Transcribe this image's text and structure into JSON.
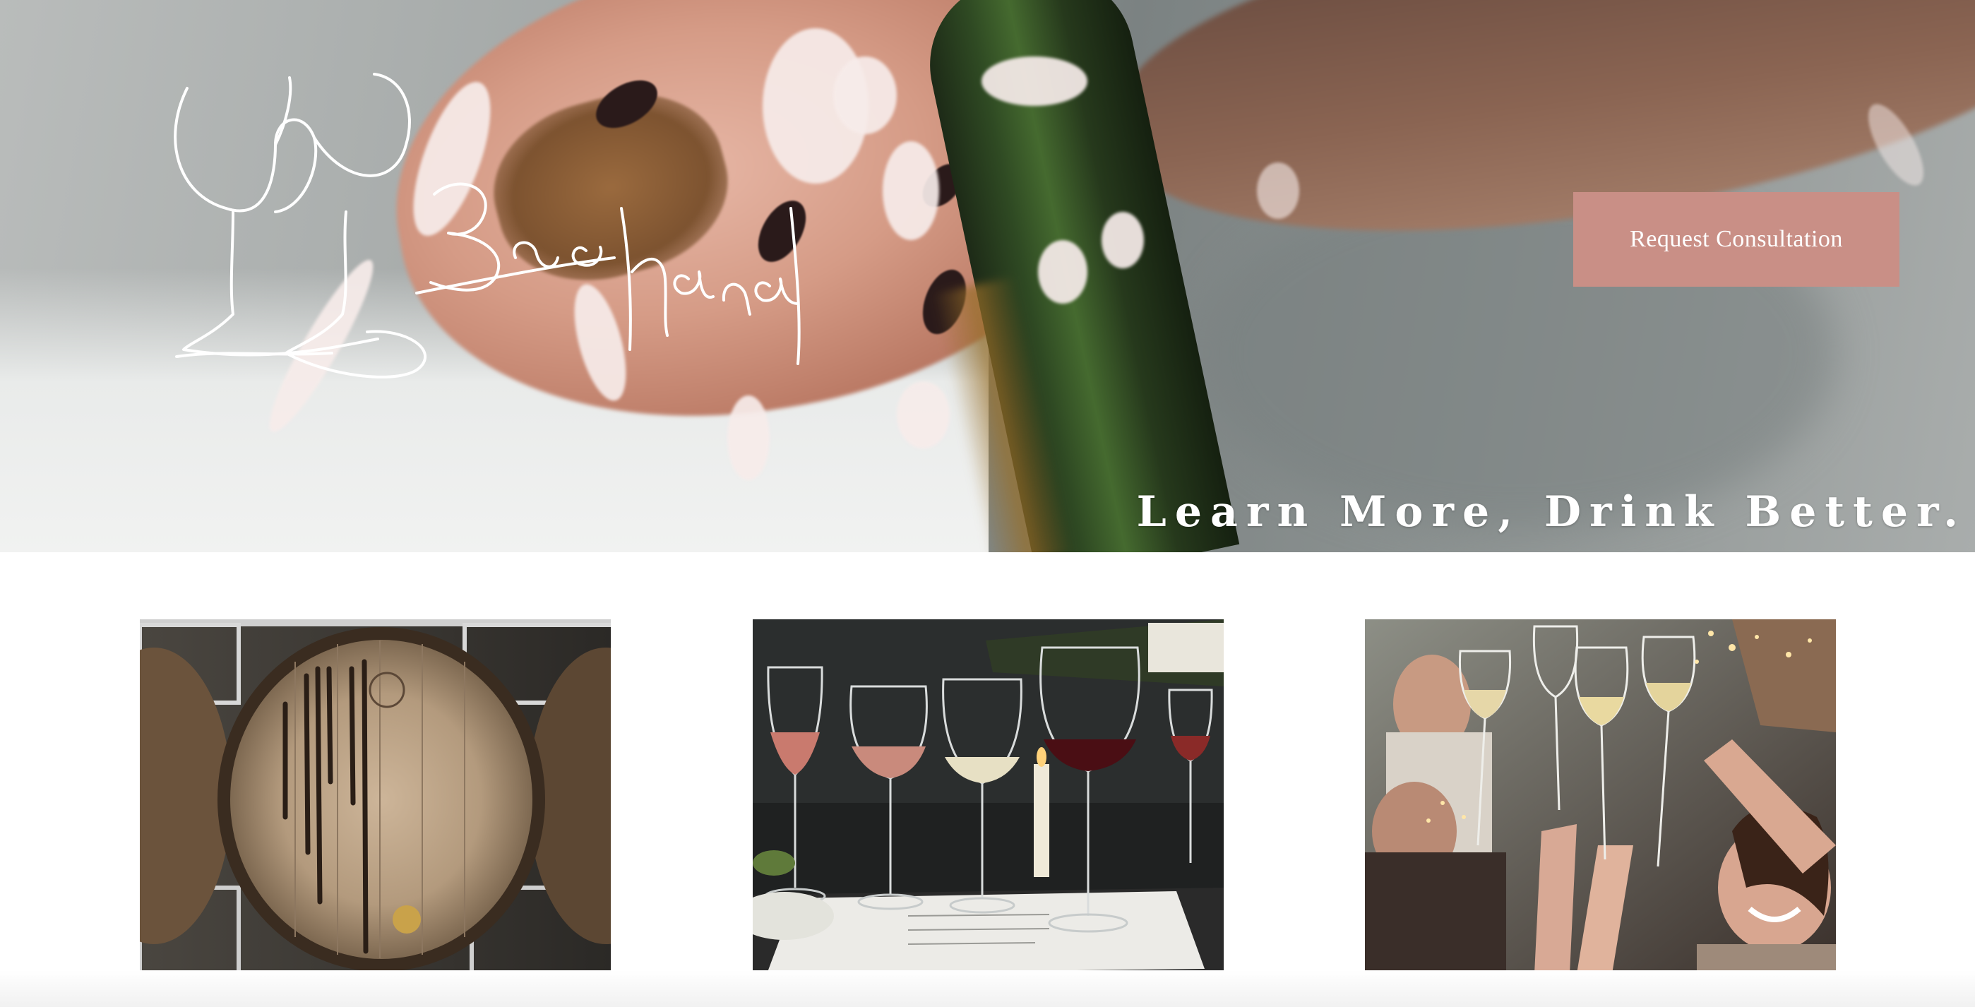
{
  "brand": {
    "name": "Bacchanal",
    "accent_color": "#c98f86"
  },
  "header": {
    "cta_label": "Request Consultation"
  },
  "hero": {
    "tagline": "Learn More, Drink Better."
  },
  "gallery": {
    "photos": [
      {
        "subject": "wine-barrel"
      },
      {
        "subject": "wine-glasses-tasting"
      },
      {
        "subject": "people-toasting"
      }
    ]
  }
}
